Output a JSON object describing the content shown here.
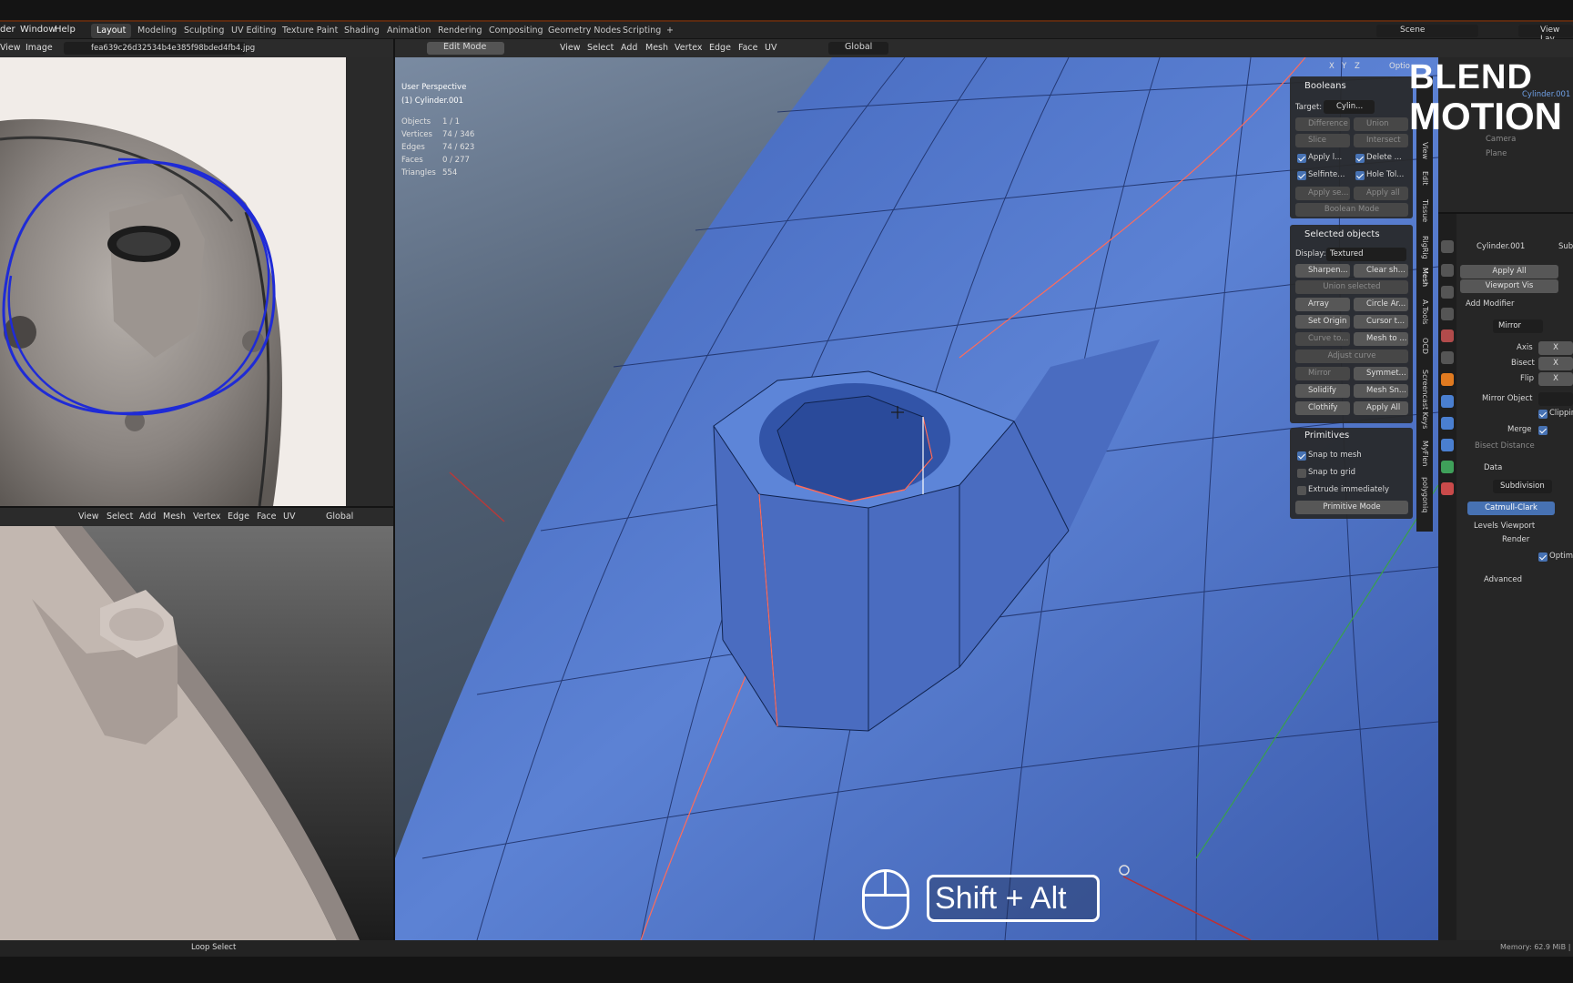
{
  "menu": {
    "items": [
      "der",
      "Window",
      "Help"
    ]
  },
  "workspaces": [
    "Layout",
    "Modeling",
    "Sculpting",
    "UV Editing",
    "Texture Paint",
    "Shading",
    "Animation",
    "Rendering",
    "Compositing",
    "Geometry Nodes",
    "Scripting",
    "+"
  ],
  "scene": {
    "label": "Scene",
    "view_layer": "View Lay"
  },
  "image_editor": {
    "view": "View",
    "image": "Image",
    "filename": "fea639c26d32534b4e385f98bded4fb4.jpg"
  },
  "viewport3d": {
    "mode": "Edit Mode",
    "menus": [
      "View",
      "Select",
      "Add",
      "Mesh",
      "Vertex",
      "Edge",
      "Face",
      "UV"
    ],
    "transform": "Global",
    "overlay_title": "User Perspective",
    "object_name": "(1) Cylinder.001",
    "stats": [
      {
        "label": "Objects",
        "value": "1 / 1"
      },
      {
        "label": "Vertices",
        "value": "74 / 346"
      },
      {
        "label": "Edges",
        "value": "74 / 623"
      },
      {
        "label": "Faces",
        "value": "0 / 277"
      },
      {
        "label": "Triangles",
        "value": "554"
      }
    ],
    "axis_buttons": [
      "X",
      "Y",
      "Z"
    ],
    "options": "Optio"
  },
  "small_viewport": {
    "menus": [
      "View",
      "Select",
      "Add",
      "Mesh",
      "Vertex",
      "Edge",
      "Face",
      "UV"
    ],
    "transform": "Global"
  },
  "booleans_panel": {
    "title": "Booleans",
    "target_label": "Target:",
    "target_value": "Cylin...",
    "difference": "Difference",
    "union": "Union",
    "slice": "Slice",
    "intersect": "Intersect",
    "apply_l": "Apply l...",
    "delete": "Delete ...",
    "self_inte": "Selfinte...",
    "hole_tol": "Hole Tol...",
    "apply_se": "Apply se...",
    "apply_all": "Apply all",
    "boolean_mode": "Boolean Mode"
  },
  "selected_panel": {
    "title": "Selected objects",
    "display_label": "Display:",
    "display_value": "Textured",
    "sharpen": "Sharpen...",
    "clear_sh": "Clear sh...",
    "union_selected": "Union selected",
    "array": "Array",
    "circle_ar": "Circle Ar...",
    "set_origin": "Set Origin",
    "cursor_t": "Cursor t...",
    "curve_to": "Curve to...",
    "mesh_to": "Mesh to ...",
    "adjust_curve": "Adjust curve",
    "mirror": "Mirror",
    "symmet": "Symmet...",
    "solidify": "Solidify",
    "mesh_sn": "Mesh Sn...",
    "clothify": "Clothify",
    "apply_all": "Apply All"
  },
  "primitives_panel": {
    "title": "Primitives",
    "snap_to_mesh": "Snap to mesh",
    "snap_to_grid": "Snap to grid",
    "extrude_immediately": "Extrude immediately",
    "primitive_mode": "Primitive Mode"
  },
  "side_tabs": [
    "View",
    "Edit",
    "Tissue",
    "RigRig",
    "Mesh",
    "A.Tools",
    "OCD",
    "Screencast Keys",
    "MyFlen",
    "polygoniq"
  ],
  "outliner": {
    "items": [
      "Cylinder.001",
      "Camera",
      "Plane"
    ]
  },
  "properties": {
    "object_name": "Cylinder.001",
    "sub": "Sub",
    "apply_all": "Apply All",
    "viewport_vis": "Viewport Vis",
    "add_modifier": "Add Modifier",
    "mirror": {
      "name": "Mirror",
      "axis": "Axis",
      "bisect": "Bisect",
      "flip": "Flip",
      "x": "X",
      "mirror_object": "Mirror Object",
      "clipping": "Clippin",
      "merge": "Merge",
      "bisect_distance": "Bisect Distance",
      "data": "Data"
    },
    "subdivision": {
      "name": "Subdivision",
      "type": "Catmull-Clark",
      "levels_viewport": "Levels Viewport",
      "render": "Render",
      "optimal": "Optima",
      "advanced": "Advanced"
    }
  },
  "logo": {
    "line1": "BLEND",
    "line2": "MOTION"
  },
  "shortcut": {
    "keys": "Shift + Alt"
  },
  "status": {
    "loop_select": "Loop Select",
    "memory": "Memory: 62.9 MiB | V"
  },
  "colors": {
    "mesh_blue": "#4a6fc4",
    "accent": "#4772b3",
    "header": "#2b2b2b"
  }
}
